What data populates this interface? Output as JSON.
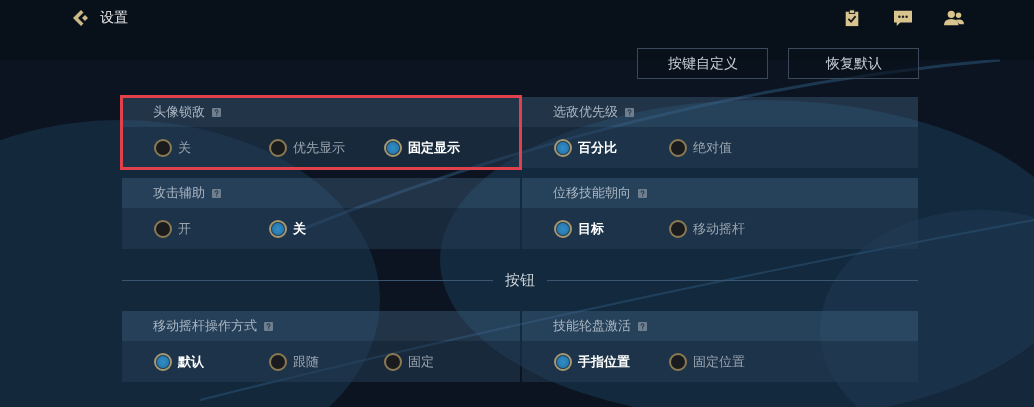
{
  "header": {
    "title": "设置"
  },
  "actions": [
    "按键自定义",
    "恢复默认"
  ],
  "sections": [
    {
      "settings": [
        {
          "label": "头像锁敌",
          "highlighted": true,
          "options": [
            {
              "label": "关",
              "selected": false
            },
            {
              "label": "优先显示",
              "selected": false
            },
            {
              "label": "固定显示",
              "selected": true
            }
          ]
        },
        {
          "label": "选敌优先级",
          "highlighted": false,
          "options": [
            {
              "label": "百分比",
              "selected": true
            },
            {
              "label": "绝对值",
              "selected": false
            }
          ]
        },
        {
          "label": "攻击辅助",
          "highlighted": false,
          "options": [
            {
              "label": "开",
              "selected": false
            },
            {
              "label": "关",
              "selected": true
            }
          ]
        },
        {
          "label": "位移技能朝向",
          "highlighted": false,
          "options": [
            {
              "label": "目标",
              "selected": true
            },
            {
              "label": "移动摇杆",
              "selected": false
            }
          ]
        }
      ]
    },
    {
      "title": "按钮",
      "settings": [
        {
          "label": "移动摇杆操作方式",
          "highlighted": false,
          "options": [
            {
              "label": "默认",
              "selected": true
            },
            {
              "label": "跟随",
              "selected": false
            },
            {
              "label": "固定",
              "selected": false
            }
          ]
        },
        {
          "label": "技能轮盘激活",
          "highlighted": false,
          "options": [
            {
              "label": "手指位置",
              "selected": true
            },
            {
              "label": "固定位置",
              "selected": false
            }
          ]
        }
      ]
    }
  ]
}
